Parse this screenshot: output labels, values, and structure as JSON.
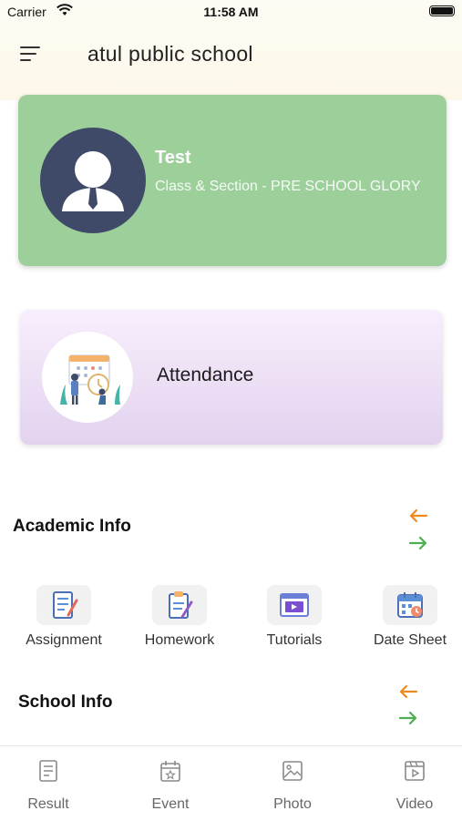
{
  "status_bar": {
    "carrier": "Carrier",
    "time": "11:58 AM"
  },
  "header": {
    "title": "atul public school",
    "menu_icon": "hamburger-menu-icon"
  },
  "profile": {
    "name": "Test",
    "class_section": "Class & Section - PRE SCHOOL GLORY",
    "avatar_icon": "user-avatar-icon",
    "card_color": "#9dcf9b"
  },
  "attendance": {
    "label": "Attendance",
    "icon": "attendance-illustration-icon"
  },
  "academic_info": {
    "title": "Academic Info",
    "items": [
      {
        "label": "Assignment",
        "icon": "assignment-icon"
      },
      {
        "label": "Homework",
        "icon": "homework-icon"
      },
      {
        "label": "Tutorials",
        "icon": "tutorials-icon"
      },
      {
        "label": "Date Sheet",
        "icon": "date-sheet-icon"
      }
    ]
  },
  "school_info": {
    "title": "School Info"
  },
  "colors": {
    "arrow_left": "#f08a1c",
    "arrow_right": "#4caf50"
  },
  "bottom_nav": [
    {
      "label": "Result",
      "icon": "result-icon"
    },
    {
      "label": "Event",
      "icon": "event-icon"
    },
    {
      "label": "Photo",
      "icon": "photo-icon"
    },
    {
      "label": "Video",
      "icon": "video-icon"
    }
  ]
}
